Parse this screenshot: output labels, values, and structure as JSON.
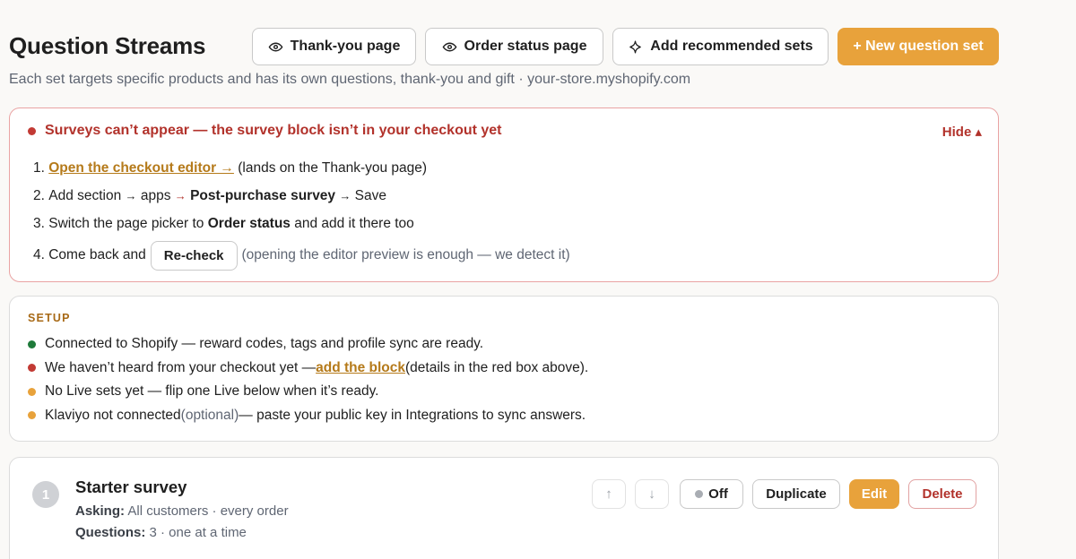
{
  "header": {
    "title": "Question Streams",
    "subtitle": "Each set targets specific products and has its own questions, thank-you and gift · your-store.myshopify.com",
    "buttons": {
      "thank_you": "Thank-you page",
      "order_status": "Order status page",
      "add_recommended": "Add recommended sets",
      "new_set": "+ New question set"
    }
  },
  "alert": {
    "title": "Surveys can’t appear — the survey block isn’t in your checkout yet",
    "hide_label": "Hide ▴",
    "color": "#b2322b",
    "steps": [
      {
        "num": "1. ",
        "link": "Open the checkout editor →",
        "rest": " (lands on the Thank-you page)"
      },
      {
        "num": "2. ",
        "a": "Add section ",
        "arrow1": "→",
        "b": " apps ",
        "arrow2": "→",
        "c": " ",
        "bold": "Post-purchase survey",
        "d": " ",
        "arrow3": "→",
        "e": " Save"
      },
      {
        "num": "3. ",
        "a": "Switch the page picker to ",
        "bold": "Order status",
        "b": " and add it there too"
      },
      {
        "num": "4. ",
        "a": "Come back and",
        "button": "Re-check",
        "note": "(opening the editor preview is enough — we detect it)"
      }
    ]
  },
  "setup": {
    "label": "SETUP",
    "items": [
      {
        "status": "green",
        "text": "Connected to Shopify — reward codes, tags and profile sync are ready."
      },
      {
        "status": "red",
        "text_before": "We haven’t heard from your checkout yet —",
        "link": "add the block",
        "text_after": "(details in the red box above)."
      },
      {
        "status": "orange",
        "text": "No Live sets yet — flip one Live below when it’s ready."
      },
      {
        "status": "orange",
        "text_before": "Klaviyo not connected",
        "optional": "(optional)",
        "text_after": "— paste your public key in Integrations to sync answers."
      }
    ]
  },
  "sets": [
    {
      "number": "1",
      "name": "Starter survey",
      "asking_label": "Asking:",
      "asking_value": " All customers · every order",
      "questions_label": "Questions:",
      "questions_value": " 3 · one at a time",
      "controls": {
        "up": "↑",
        "down": "↓",
        "status": "Off",
        "duplicate": "Duplicate",
        "edit": "Edit",
        "delete": "Delete"
      }
    }
  ],
  "colors": {
    "accent": "#e8a23b",
    "danger": "#b2322b",
    "link": "#b57a1a",
    "ok": "#1f7a3a"
  },
  "icons": [
    "eye-icon",
    "sparkle-icon",
    "status-dot-icon"
  ]
}
